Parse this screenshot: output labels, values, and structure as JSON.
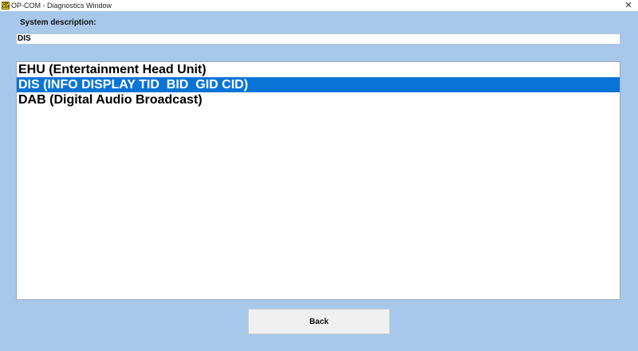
{
  "window": {
    "title": "OP-COM - Diagnostics Window",
    "icon_text": "OP COM",
    "close_label": "✕"
  },
  "form": {
    "description_label": "System description:",
    "description_value": "DIS"
  },
  "systems_list": {
    "items": [
      {
        "label": "EHU (Entertainment Head Unit)",
        "selected": false
      },
      {
        "label": "DIS (INFO DISPLAY TID  BID  GID CID)",
        "selected": true
      },
      {
        "label": "DAB (Digital Audio Broadcast)",
        "selected": false
      }
    ]
  },
  "actions": {
    "back_label": "Back"
  },
  "colors": {
    "background": "#a7c8ea",
    "selection": "#0a74d6"
  }
}
